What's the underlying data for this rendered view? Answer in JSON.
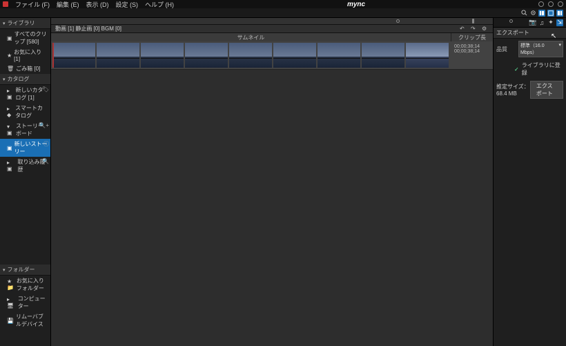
{
  "app": {
    "title": "mync"
  },
  "menu": {
    "file": "ファイル (F)",
    "edit": "編集 (E)",
    "view": "表示 (D)",
    "settings": "設定 (S)",
    "help": "ヘルプ (H)"
  },
  "sidebar": {
    "lib_header": "ライブラリ",
    "all_clips": "すべてのクリップ [580]",
    "favorites": "お気に入り [1]",
    "trash": "ごみ箱 [0]",
    "catalog_header": "カタログ",
    "new_catalog": "新しいカタログ [1]",
    "smart_catalog": "スマートカタログ",
    "storyboard": "ストーリーボード",
    "new_story": "新しいストーリー",
    "import_history": "取り込み履歴",
    "folder_header": "フォルダー",
    "fav_folder": "お気に入りフォルダー",
    "computer": "コンピューター",
    "removable": "リムーバブルデバイス"
  },
  "center": {
    "types": "動画 [1]  静止画 [0]  BGM [0]",
    "thumb_header": "サムネイル",
    "clip_len_header": "クリップ長",
    "time1": "00;00;38;14",
    "time2": "00;00;38;14"
  },
  "rpanel": {
    "export_header": "エクスポート",
    "quality_label": "品質",
    "quality_value": "標準（16.0 Mbps）",
    "register_lib": "ライブラリに登録",
    "est_size_label": "推定サイズ：",
    "est_size_value": "68.4 MB",
    "export_btn": "エクスポート"
  }
}
